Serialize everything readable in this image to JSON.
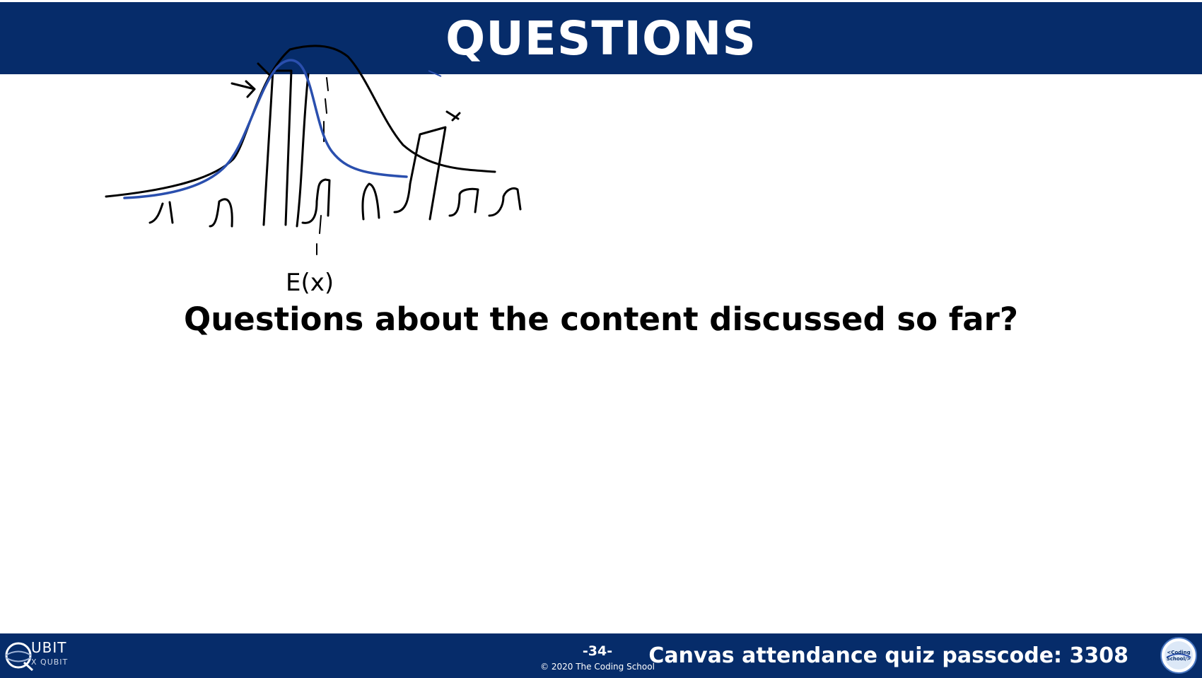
{
  "slide": {
    "title": "QUESTIONS",
    "question": "Questions about the content discussed so far?"
  },
  "sketch": {
    "label": "E(x)"
  },
  "footer": {
    "logo_text": "UBIT",
    "logo_subtext": "X QUBIT",
    "page_number": "-34-",
    "copyright": "© 2020 The Coding School",
    "passcode": "Canvas attendance quiz passcode: 3308",
    "badge_text": "The Coding School"
  },
  "colors": {
    "header": "#062c6a",
    "ink_black": "#000000",
    "ink_blue": "#2a4fae"
  }
}
